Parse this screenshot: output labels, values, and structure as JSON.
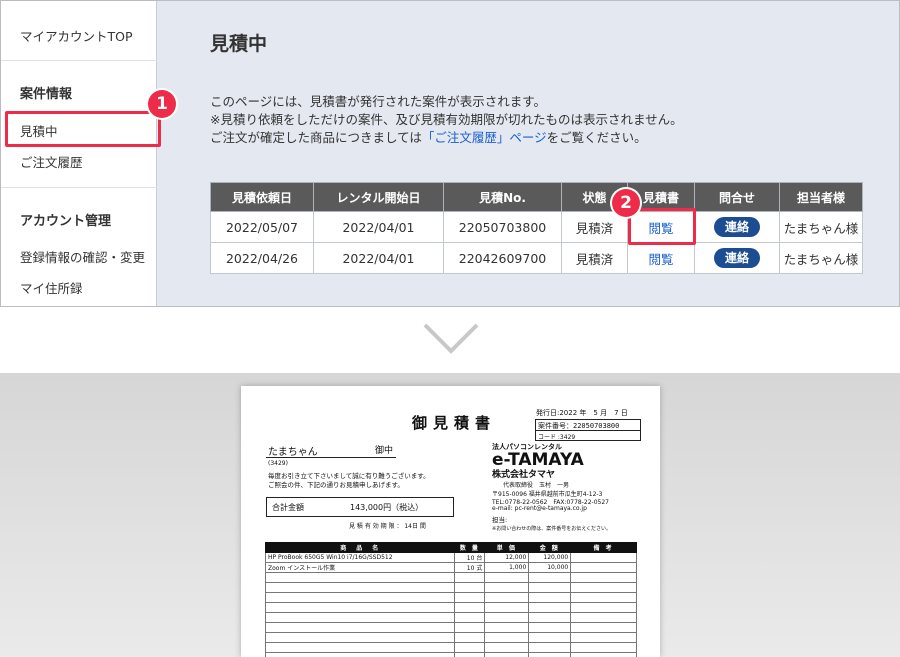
{
  "sidebar": {
    "account_top": "マイアカウントTOP",
    "case_heading": "案件情報",
    "quote_pending": "見積中",
    "order_history": "ご注文履歴",
    "account_heading": "アカウント管理",
    "registration": "登録情報の確認・変更",
    "address_book": "マイ住所録"
  },
  "badges": {
    "step1": "1",
    "step2": "2"
  },
  "main": {
    "title": "見積中",
    "desc1": "このページには、見積書が発行された案件が表示されます。",
    "desc2": "※見積り依頼をしただけの案件、及び見積有効期限が切れたものは表示されません。",
    "desc3_pre": "ご注文が確定した商品につきましては",
    "desc3_link": "「ご注文履歴」ページ",
    "desc3_post": "をご覧ください。"
  },
  "table": {
    "headers": [
      "見積依頼日",
      "レンタル開始日",
      "見積No.",
      "状態",
      "見積書",
      "問合せ",
      "担当者様"
    ],
    "rows": [
      {
        "request_date": "2022/05/07",
        "start_date": "2022/04/01",
        "quote_no": "22050703800",
        "status": "見積済",
        "view": "閲覧",
        "contact": "連絡",
        "person": "たまちゃん様"
      },
      {
        "request_date": "2022/04/26",
        "start_date": "2022/04/01",
        "quote_no": "22042609700",
        "status": "見積済",
        "view": "閲覧",
        "contact": "連絡",
        "person": "たまちゃん様"
      }
    ]
  },
  "doc": {
    "title": "御見積書",
    "issue_date": "発行日:2022 年　5 月　7 日",
    "case_no": "案件番号：22050703800",
    "code": "コード :3429",
    "customer": "たまちゃん",
    "honorific": "御中",
    "customer_code": "(3429)",
    "greeting1": "毎度お引き立て下さいまして誠に有り難うございます。",
    "greeting2": "ご照会の件、下記の通りお見積申しあげます。",
    "total_label": "合計金額",
    "total_value": "143,000円（税込）",
    "validity": "見 積 有 効 期 限 ： 14日 間",
    "company_tagline": "法人パソコンレンタル",
    "company_brand": "e-TAMAYA",
    "company_name": "株式会社タマヤ",
    "representative": "代表取締役　玉村　一男",
    "address": "〒915-0096 福井県越前市瓜生町4-12-3",
    "tel": "TEL:0778-22-0562　FAX:0778-22-0527",
    "email": "e-mail: pc-rent@e-tamaya.co.jp",
    "staff": "担当:",
    "note": "※お問い合わせの際は、案件番号をお伝えください。",
    "table_headers": [
      "商　品　名",
      "数 量",
      "単 価",
      "金 額",
      "備 考"
    ],
    "items": [
      {
        "name": "HP ProBook 650G5 Win10 i7/16G/SSD512",
        "qty": "10 台",
        "unit": "12,000",
        "amount": "120,000"
      },
      {
        "name": "Zoom インストール作業",
        "qty": "10 式",
        "unit": "1,000",
        "amount": "10,000"
      }
    ]
  }
}
